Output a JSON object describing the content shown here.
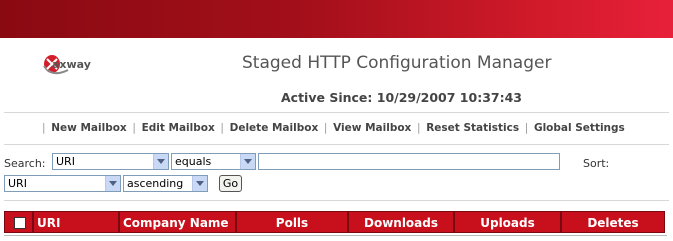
{
  "app": {
    "logo_text": "axway",
    "title": "Staged HTTP Configuration Manager",
    "active_since": "Active Since: 10/29/2007 10:37:43"
  },
  "nav": {
    "items": [
      "New Mailbox",
      "Edit Mailbox",
      "Delete Mailbox",
      "View Mailbox",
      "Reset Statistics",
      "Global Settings"
    ]
  },
  "search": {
    "label": "Search:",
    "field_value": "URI",
    "operator_value": "equals",
    "text_value": "",
    "sort_label": "Sort:",
    "sort_field_value": "URI",
    "sort_order_value": "ascending",
    "go_label": "Go"
  },
  "table": {
    "columns": [
      "URI",
      "Company Name",
      "Polls",
      "Downloads",
      "Uploads",
      "Deletes"
    ]
  },
  "colors": {
    "banner": "#a30f1a",
    "header_bg": "#c8101c"
  }
}
